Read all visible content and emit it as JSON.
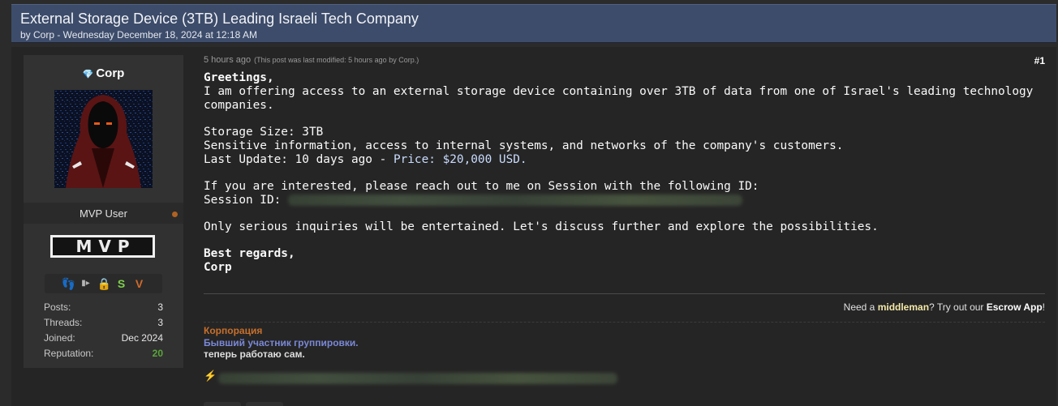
{
  "thread": {
    "title": "External Storage Device (3TB) Leading Israeli Tech Company",
    "byline": "by Corp - Wednesday December 18, 2024 at 12:18 AM"
  },
  "author": {
    "name": "Corp",
    "user_title": "MVP User",
    "rank_badge": "MVP",
    "awards": [
      "bounty-icon",
      "rocket-icon",
      "lock-icon",
      "dollar-s-icon",
      "chevron-v-icon"
    ],
    "stats": [
      {
        "label": "Posts:",
        "value": "3"
      },
      {
        "label": "Threads:",
        "value": "3"
      },
      {
        "label": "Joined:",
        "value": "Dec 2024"
      },
      {
        "label": "Reputation:",
        "value": "20"
      }
    ]
  },
  "post": {
    "time": "5 hours ago",
    "modified_note": "(This post was last modified: 5 hours ago by Corp.)",
    "number": "#1",
    "greeting": "Greetings,",
    "line1": "I am offering access to an external storage device containing over 3TB of data from one of Israel's leading technology companies.",
    "storage": "Storage Size: 3TB",
    "sensitive": "Sensitive information, access to internal systems, and networks of the company's customers.",
    "update_prefix": "Last Update: 10 days ago - ",
    "price_label": "Price: ",
    "price_value": "$20,000 USD",
    "price_suffix": ".",
    "contact": "If you are interested, please reach out to me on Session with the following ID:",
    "session_label": "Session ID:",
    "serious": "Only serious inquiries will be entertained. Let's discuss further and explore the possibilities.",
    "sign1": "Best regards,",
    "sign2": "Corp"
  },
  "escrow": {
    "prefix": "Need a ",
    "middleman": "middleman",
    "mid": "? Try out our ",
    "app": "Escrow App",
    "suffix": "!"
  },
  "signature": {
    "line1": "Корпорация",
    "line2": "Бывший участник группировки.",
    "line3": "теперь работаю сам.",
    "bolt": "⚡"
  },
  "colors": {
    "header_bg": "#3d4c6a",
    "reputation": "#5aa53b",
    "sig_orange": "#c8702c",
    "sig_blue": "#7a88d6"
  }
}
